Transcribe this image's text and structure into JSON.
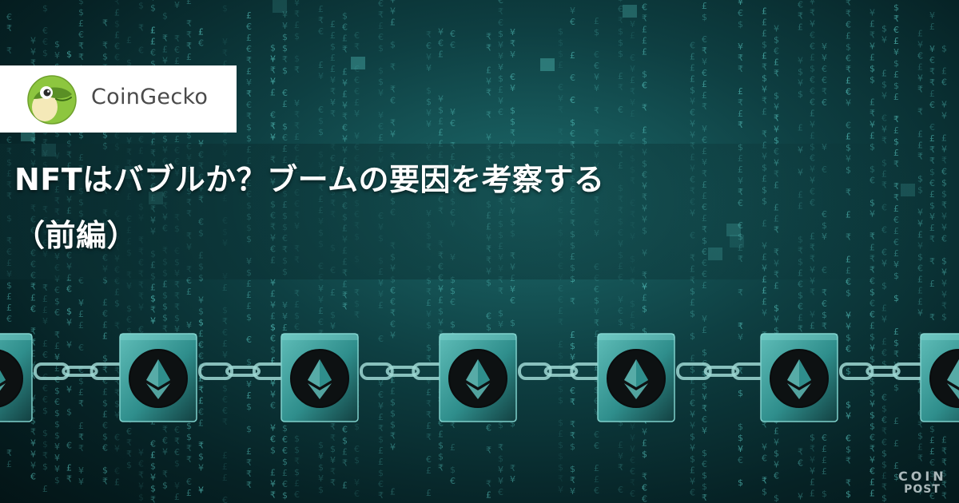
{
  "brand": {
    "logo_name": "CoinGecko",
    "logo_icon": "gecko-icon"
  },
  "headline": {
    "line1": "NFTはバブルか？ブームの要因を考察する",
    "line2": "（前編）"
  },
  "watermark": {
    "line1": "COIN",
    "line2": "POST"
  },
  "illustration": {
    "subject": "ethereum-block-chain",
    "block_icon": "ethereum-icon",
    "background_symbols": [
      "$",
      "¥",
      "€",
      "₹",
      "£"
    ]
  },
  "colors": {
    "background_dark": "#031416",
    "background_teal": "#1d6b6c",
    "matrix_glyph": "#5fd6cf",
    "block_face": "#2f8e8c",
    "logo_bg": "#ffffff",
    "gecko_green": "#8dc63f",
    "headline_text": "#ffffff"
  }
}
